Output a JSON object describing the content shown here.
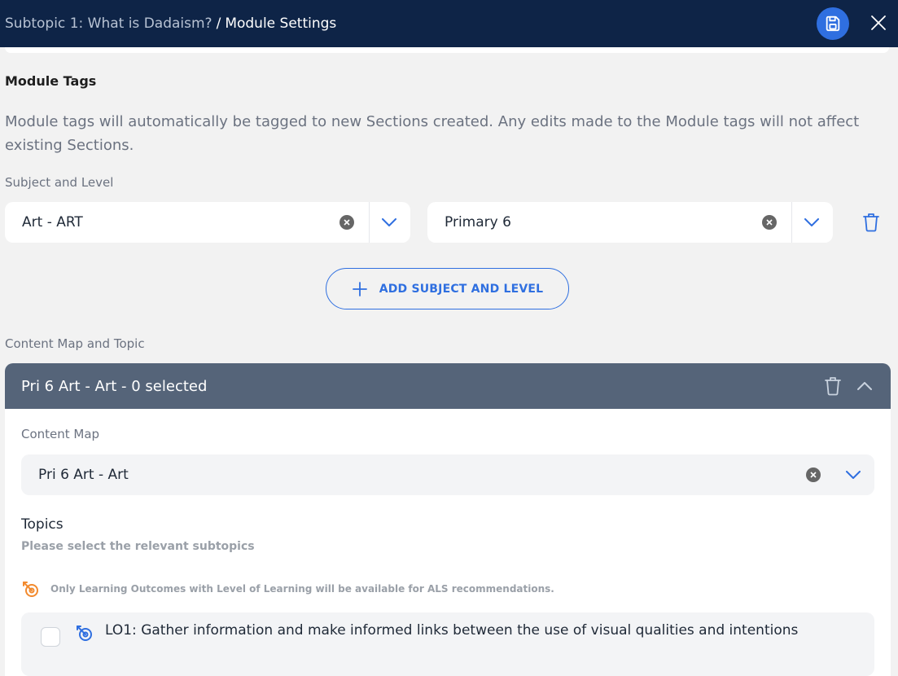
{
  "header": {
    "breadcrumb_parent": "Subtopic 1: What is Dadaism?",
    "breadcrumb_separator": "/",
    "breadcrumb_current": "Module Settings",
    "save_icon": "save-icon",
    "close_icon": "close-icon"
  },
  "module_tags": {
    "title": "Module Tags",
    "description": "Module tags will automatically be tagged to new Sections created. Any edits made to the Module tags will not affect existing Sections.",
    "subject_level_label": "Subject and Level",
    "subject_value": "Art - ART",
    "level_value": "Primary 6",
    "add_button_label": "ADD SUBJECT AND LEVEL"
  },
  "content_map_section": {
    "label": "Content Map and Topic",
    "accordion_title": "Pri 6 Art - Art - 0 selected",
    "content_map_label": "Content Map",
    "content_map_value": "Pri 6 Art - Art",
    "topics_title": "Topics",
    "topics_subtitle": "Please select the relevant subtopics",
    "als_note": "Only Learning Outcomes with Level of Learning will be available for ALS recommendations.",
    "learning_outcomes": [
      {
        "label": "LO1: Gather information and make informed links between the use of visual qualities and intentions",
        "checked": false
      }
    ]
  },
  "colors": {
    "header_bg": "#0e2447",
    "accent": "#2f6fe0",
    "accordion_bg": "#556479",
    "target_icon": "#f28a2e"
  }
}
